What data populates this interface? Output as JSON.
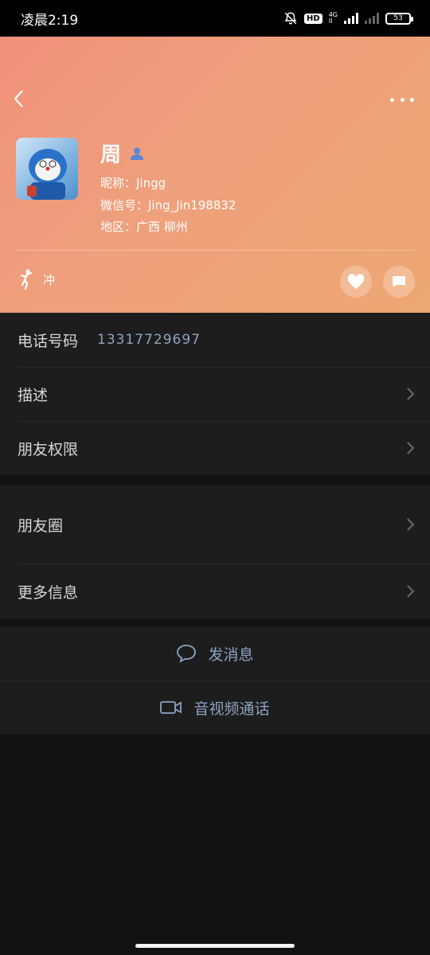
{
  "status_bar": {
    "time": "凌晨2:19",
    "hd": "HD",
    "net_top": "4G",
    "net_bottom": "II",
    "battery": "53"
  },
  "profile": {
    "name": "周",
    "nickname": "昵称：Jingg",
    "wechat_id": "微信号：Jing_Jin198832",
    "region": "地区：广西  柳州",
    "status_text": "冲"
  },
  "rows": {
    "phone_label": "电话号码",
    "phone_value": "13317729697",
    "description": "描述",
    "permissions": "朋友权限",
    "moments": "朋友圈",
    "more_info": "更多信息"
  },
  "actions": {
    "send_message": "发消息",
    "video_call": "音视频通话"
  },
  "colors": {
    "header_gradient_start": "#f0907a",
    "header_gradient_end": "#eea872",
    "accent_link": "#8ea3c2",
    "row_bg": "#1d1d1d",
    "page_bg": "#111111"
  }
}
